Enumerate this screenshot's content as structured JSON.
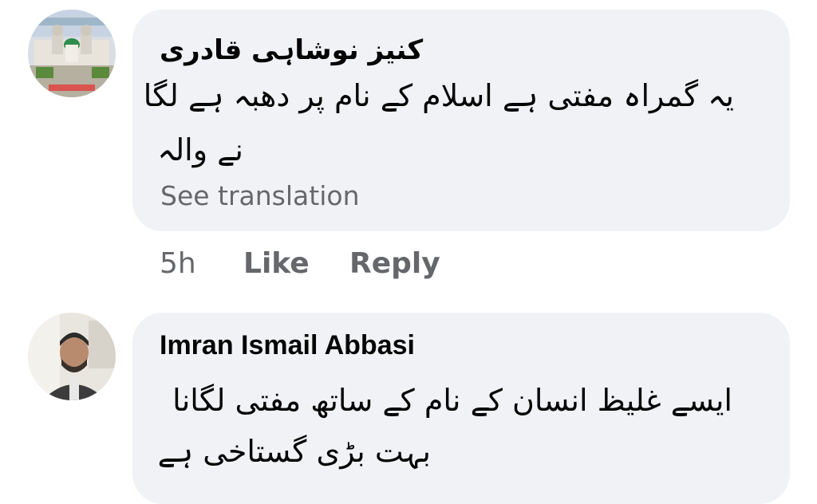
{
  "comments": [
    {
      "author": "کنیز نوشاہی قادری",
      "lines": [
        "یہ گمراہ مفتی ہے اسلام کے نام پر دھبہ ہے لگا",
        "نے والہ"
      ],
      "see_translation": "See translation",
      "time": "5h",
      "like_label": "Like",
      "reply_label": "Reply"
    },
    {
      "author": "Imran Ismail Abbasi",
      "lines": [
        "ایسے غلیظ انسان کے نام کے ساتھ مفتی لگانا",
        "بہت بڑی گستاخی ہے"
      ]
    }
  ],
  "colors": {
    "bubble_bg": "#f0f2f5",
    "primary_text": "#050505",
    "secondary_text": "#65676b"
  }
}
